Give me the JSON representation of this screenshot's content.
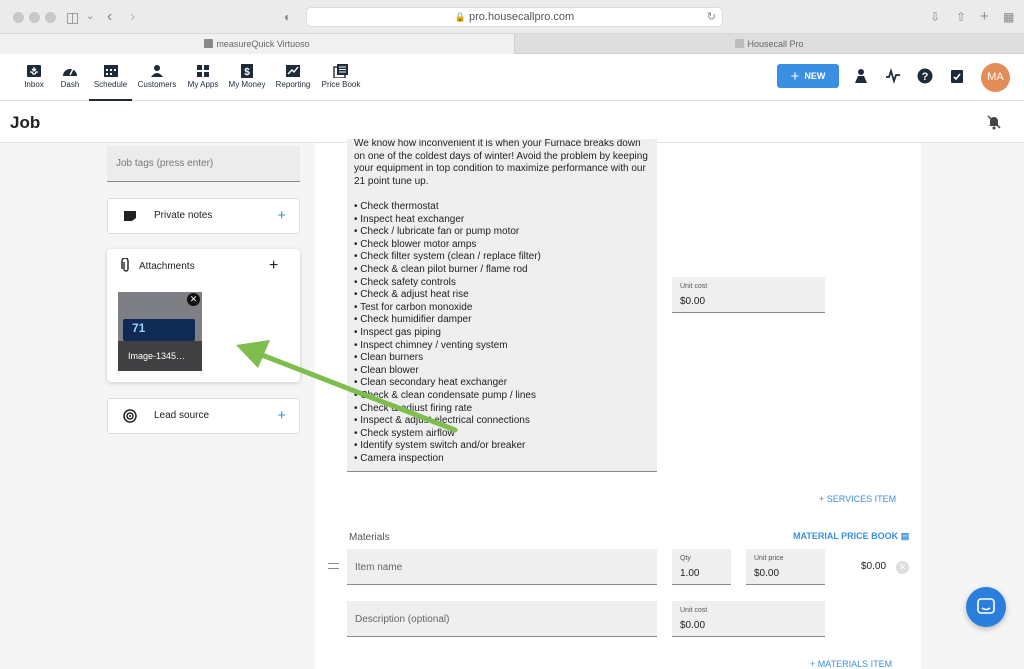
{
  "browser": {
    "url": "pro.housecallpro.com",
    "tabs": [
      {
        "label": "measureQuick Virtuoso"
      },
      {
        "label": "Housecall Pro"
      }
    ]
  },
  "nav": {
    "items": [
      {
        "label": "Inbox",
        "icon": "inbox-icon"
      },
      {
        "label": "Dash",
        "icon": "dashboard-icon"
      },
      {
        "label": "Schedule",
        "icon": "calendar-icon"
      },
      {
        "label": "Customers",
        "icon": "customers-icon"
      },
      {
        "label": "My Apps",
        "icon": "apps-icon"
      },
      {
        "label": "My Money",
        "icon": "money-icon"
      },
      {
        "label": "Reporting",
        "icon": "chart-icon"
      },
      {
        "label": "Price Book",
        "icon": "book-icon"
      }
    ],
    "active": "Schedule",
    "new_button": "NEW",
    "avatar_initials": "MA"
  },
  "page": {
    "title": "Job"
  },
  "left": {
    "job_tags_placeholder": "Job tags (press enter)",
    "private_notes": "Private notes",
    "attachments": "Attachments",
    "attachment_caption": "Image-1345…",
    "thumbnail_temp": "71",
    "lead_source": "Lead source"
  },
  "service": {
    "description_intro": "We know how inconvenient it is when your Furnace breaks down on one of the coldest days of winter! Avoid the problem by keeping your equipment in top condition to maximize performance with our 21 point tune up.",
    "checklist": [
      "Check thermostat",
      "Inspect heat exchanger",
      "Check / lubricate fan or pump motor",
      "Check blower motor amps",
      "Check filter system (clean / replace filter)",
      "Check & clean pilot burner / flame rod",
      "Check safety controls",
      "Check & adjust heat rise",
      "Test for carbon monoxide",
      "Check humidifier damper",
      "Inspect gas piping",
      "Inspect chimney / venting system",
      "Clean burners",
      "Clean blower",
      "Clean secondary heat exchanger",
      "Check & clean condensate pump / lines",
      "Check & adjust firing rate",
      "Inspect & adjust electrical connections",
      "Check system airflow",
      "Identify system switch and/or breaker",
      "Camera inspection"
    ],
    "unit_cost_label": "Unit cost",
    "unit_cost_value": "$0.00",
    "add_services_item": "+ SERVICES ITEM"
  },
  "materials": {
    "title": "Materials",
    "price_book_link": "MATERIAL PRICE BOOK",
    "item_name_placeholder": "Item name",
    "qty_label": "Qty",
    "qty_value": "1.00",
    "unit_price_label": "Unit price",
    "unit_price_value": "$0.00",
    "line_total": "$0.00",
    "description_placeholder": "Description (optional)",
    "unit_cost_label": "Unit cost",
    "unit_cost_value": "$0.00",
    "add_materials_item": "+ MATERIALS ITEM"
  },
  "colors": {
    "accent": "#3a8fe3",
    "annotation_arrow": "#7fbd4f",
    "avatar": "#e28c57"
  }
}
